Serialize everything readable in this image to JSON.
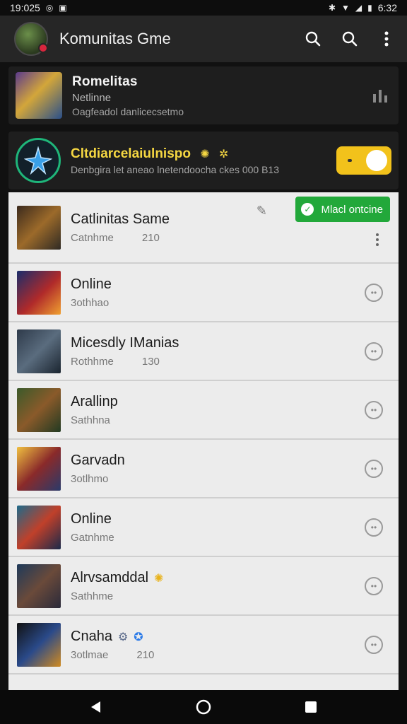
{
  "status": {
    "time": "19:025",
    "right_time": "6:32"
  },
  "appbar": {
    "title": "Komunitas Gme"
  },
  "card1": {
    "title": "Romelitas",
    "subtitle": "Netlinne",
    "meta": "Oagfeadol danlicecsetmo"
  },
  "card2": {
    "title": "Cltdiarcelaiulnispo",
    "meta": "Denbgira let aneao lnetendoocha ckes 000 B13"
  },
  "online_button": {
    "label": "Mlacl ontcine"
  },
  "list": [
    {
      "title": "Catlinitas Same",
      "sub": "Catnhme",
      "count": "210"
    },
    {
      "title": "Online",
      "sub": "3othhao",
      "count": ""
    },
    {
      "title": "Micesdly IManias",
      "sub": "Rothhme",
      "count": "130"
    },
    {
      "title": "Arallinp",
      "sub": "Sathhna",
      "count": ""
    },
    {
      "title": "Garvadn",
      "sub": "3otlhmo",
      "count": ""
    },
    {
      "title": "Online",
      "sub": "Gatnhme",
      "count": ""
    },
    {
      "title": "Alrvsamddal",
      "sub": "Sathhme",
      "count": ""
    },
    {
      "title": "Cnaha",
      "sub": "3otlmae",
      "count": "210"
    }
  ],
  "colors": {
    "accent_green": "#22a83a",
    "toggle_yellow": "#f2c21b",
    "star_ring": "#1fb67a"
  },
  "icons": [
    "search-icon",
    "search-icon",
    "more-vert-icon",
    "chat-icon",
    "back-icon",
    "home-icon",
    "recents-icon"
  ]
}
